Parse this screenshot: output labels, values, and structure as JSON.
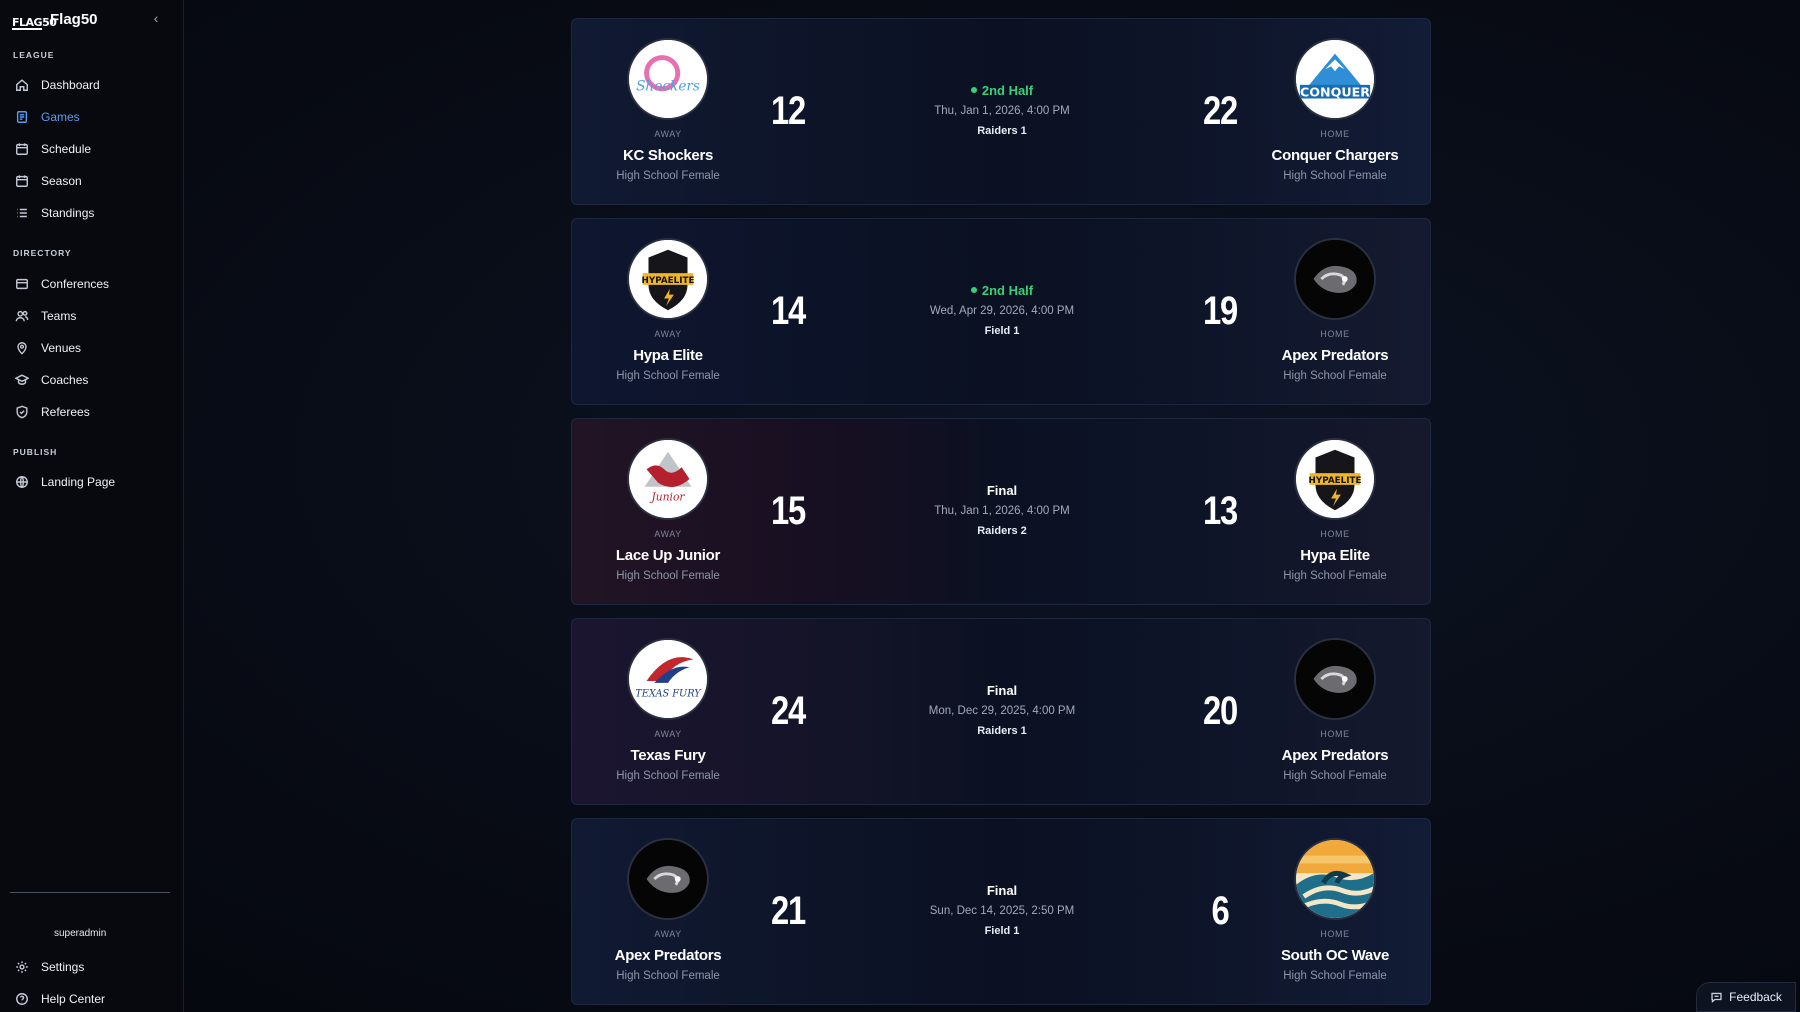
{
  "app": {
    "brand_logo": "FLAG50",
    "brand_name": "Flag50"
  },
  "sidebar": {
    "sections": [
      {
        "label": "LEAGUE",
        "items": [
          {
            "label": "Dashboard",
            "icon": "home-icon"
          },
          {
            "label": "Games",
            "icon": "games-icon",
            "active": true
          },
          {
            "label": "Schedule",
            "icon": "calendar-icon"
          },
          {
            "label": "Season",
            "icon": "calendar-icon"
          },
          {
            "label": "Standings",
            "icon": "list-icon"
          }
        ]
      },
      {
        "label": "DIRECTORY",
        "items": [
          {
            "label": "Conferences",
            "icon": "layers-icon"
          },
          {
            "label": "Teams",
            "icon": "users-icon"
          },
          {
            "label": "Venues",
            "icon": "map-pin-icon"
          },
          {
            "label": "Coaches",
            "icon": "graduation-cap-icon"
          },
          {
            "label": "Referees",
            "icon": "shield-icon"
          }
        ]
      },
      {
        "label": "PUBLISH",
        "items": [
          {
            "label": "Landing Page",
            "icon": "globe-icon"
          }
        ]
      }
    ],
    "user": "superadmin",
    "footer_items": [
      {
        "label": "Settings",
        "icon": "gear-icon"
      },
      {
        "label": "Help Center",
        "icon": "help-icon"
      }
    ]
  },
  "games": [
    {
      "status": "2nd Half",
      "live": true,
      "datetime": "Thu, Jan 1, 2026, 4:00 PM",
      "venue": "Raiders 1",
      "away": {
        "label": "AWAY",
        "name": "KC Shockers",
        "division": "High School Female",
        "score": "12",
        "logo_text": "Shockers"
      },
      "home": {
        "label": "HOME",
        "name": "Conquer Chargers",
        "division": "High School Female",
        "score": "22",
        "logo_text": "CONQUER"
      }
    },
    {
      "status": "2nd Half",
      "live": true,
      "datetime": "Wed, Apr 29, 2026, 4:00 PM",
      "venue": "Field 1",
      "away": {
        "label": "AWAY",
        "name": "Hypa Elite",
        "division": "High School Female",
        "score": "14",
        "logo_text": "HYPAELITE"
      },
      "home": {
        "label": "HOME",
        "name": "Apex Predators",
        "division": "High School Female",
        "score": "19",
        "logo_text": ""
      }
    },
    {
      "status": "Final",
      "live": false,
      "datetime": "Thu, Jan 1, 2026, 4:00 PM",
      "venue": "Raiders 2",
      "away": {
        "label": "AWAY",
        "name": "Lace Up Junior",
        "division": "High School Female",
        "score": "15",
        "logo_text": "Junior"
      },
      "home": {
        "label": "HOME",
        "name": "Hypa Elite",
        "division": "High School Female",
        "score": "13",
        "logo_text": "HYPAELITE"
      }
    },
    {
      "status": "Final",
      "live": false,
      "datetime": "Mon, Dec 29, 2025, 4:00 PM",
      "venue": "Raiders 1",
      "away": {
        "label": "AWAY",
        "name": "Texas Fury",
        "division": "High School Female",
        "score": "24",
        "logo_text": "TEXAS FURY"
      },
      "home": {
        "label": "HOME",
        "name": "Apex Predators",
        "division": "High School Female",
        "score": "20",
        "logo_text": ""
      }
    },
    {
      "status": "Final",
      "live": false,
      "datetime": "Sun, Dec 14, 2025, 2:50 PM",
      "venue": "Field 1",
      "away": {
        "label": "AWAY",
        "name": "Apex Predators",
        "division": "High School Female",
        "score": "21",
        "logo_text": ""
      },
      "home": {
        "label": "HOME",
        "name": "South OC Wave",
        "division": "High School Female",
        "score": "6",
        "logo_text": ""
      }
    }
  ],
  "feedback": {
    "label": "Feedback"
  },
  "colors": {
    "accent": "#5b9cf0",
    "live": "#3ccf7a",
    "background": "#080c16"
  }
}
